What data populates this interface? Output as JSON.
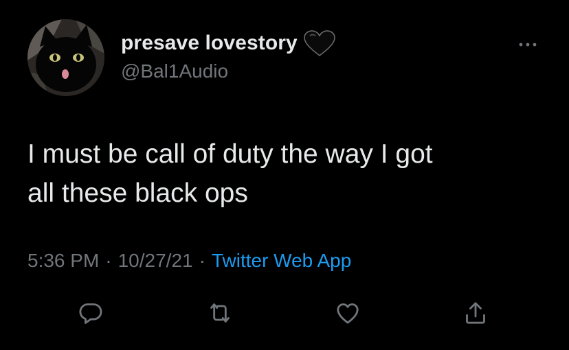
{
  "user": {
    "display_name": "presave lovestory",
    "handle": "@Bal1Audio",
    "name_emoji": "black-heart-icon",
    "avatar": "black-cat-avatar"
  },
  "tweet": {
    "line1": "I must be call of duty the way I got",
    "line2": "all these black ops"
  },
  "meta": {
    "time": "5:36 PM",
    "separator1": "·",
    "date": "10/27/21",
    "separator2": "·",
    "source": "Twitter Web App"
  },
  "actions": [
    "reply-icon",
    "retweet-icon",
    "like-icon",
    "share-icon"
  ],
  "colors": {
    "background": "#000000",
    "text": "#e7e9ea",
    "secondary_text": "#71767b",
    "link": "#1d9bf0"
  }
}
